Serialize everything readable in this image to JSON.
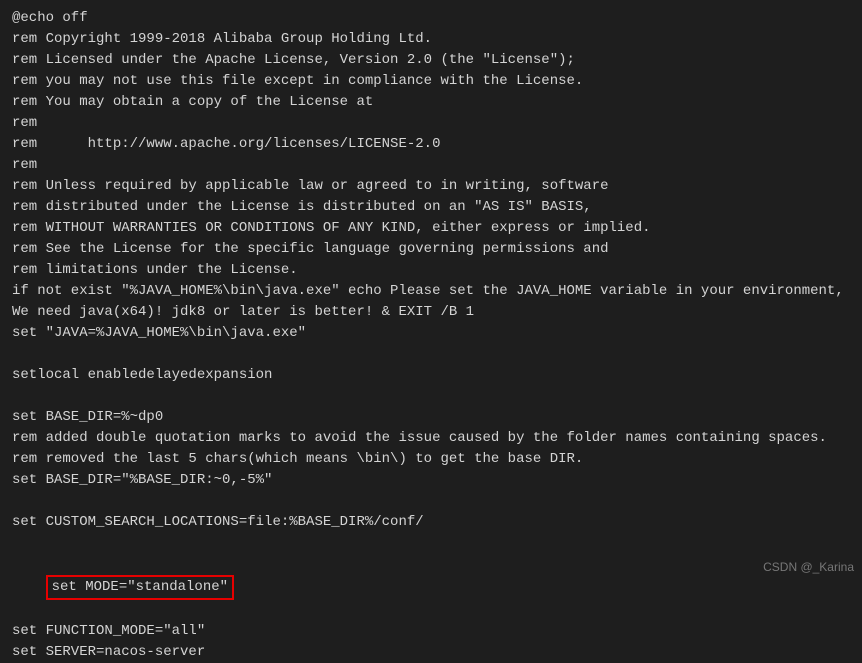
{
  "lines": {
    "l0": "@echo off",
    "l1": "rem Copyright 1999-2018 Alibaba Group Holding Ltd.",
    "l2": "rem Licensed under the Apache License, Version 2.0 (the \"License\");",
    "l3": "rem you may not use this file except in compliance with the License.",
    "l4": "rem You may obtain a copy of the License at",
    "l5": "rem",
    "l6": "rem      http://www.apache.org/licenses/LICENSE-2.0",
    "l7": "rem",
    "l8": "rem Unless required by applicable law or agreed to in writing, software",
    "l9": "rem distributed under the License is distributed on an \"AS IS\" BASIS,",
    "l10": "rem WITHOUT WARRANTIES OR CONDITIONS OF ANY KIND, either express or implied.",
    "l11": "rem See the License for the specific language governing permissions and",
    "l12": "rem limitations under the License.",
    "l13": "if not exist \"%JAVA_HOME%\\bin\\java.exe\" echo Please set the JAVA_HOME variable in your environment, We need java(x64)! jdk8 or later is better! & EXIT /B 1",
    "l14": "set \"JAVA=%JAVA_HOME%\\bin\\java.exe\"",
    "l15": "",
    "l16": "setlocal enabledelayedexpansion",
    "l17": "",
    "l18": "set BASE_DIR=%~dp0",
    "l19": "rem added double quotation marks to avoid the issue caused by the folder names containing spaces.",
    "l20": "rem removed the last 5 chars(which means \\bin\\) to get the base DIR.",
    "l21": "set BASE_DIR=\"%BASE_DIR:~0,-5%\"",
    "l22": "",
    "l23": "set CUSTOM_SEARCH_LOCATIONS=file:%BASE_DIR%/conf/",
    "l24": "",
    "l25": "set MODE=\"standalone\"",
    "l26": "set FUNCTION_MODE=\"all\"",
    "l27": "set SERVER=nacos-server"
  },
  "watermark": "CSDN @_Karina"
}
